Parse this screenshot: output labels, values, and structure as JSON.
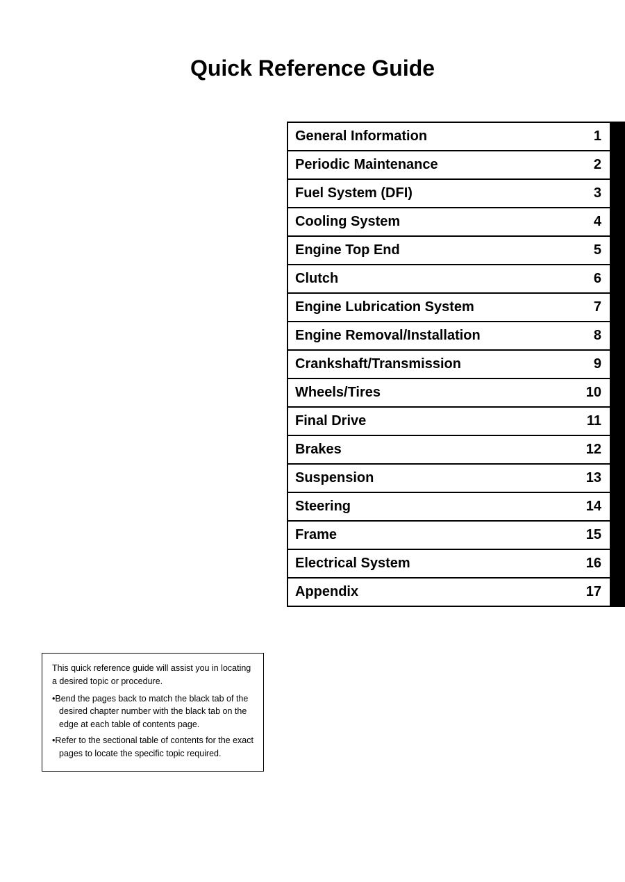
{
  "page": {
    "title": "Quick Reference Guide",
    "toc_items": [
      {
        "label": "General Information",
        "number": "1"
      },
      {
        "label": "Periodic Maintenance",
        "number": "2"
      },
      {
        "label": "Fuel System (DFI)",
        "number": "3"
      },
      {
        "label": "Cooling System",
        "number": "4"
      },
      {
        "label": "Engine Top End",
        "number": "5"
      },
      {
        "label": "Clutch",
        "number": "6"
      },
      {
        "label": "Engine Lubrication System",
        "number": "7"
      },
      {
        "label": "Engine Removal/Installation",
        "number": "8"
      },
      {
        "label": "Crankshaft/Transmission",
        "number": "9"
      },
      {
        "label": "Wheels/Tires",
        "number": "10"
      },
      {
        "label": "Final Drive",
        "number": "11"
      },
      {
        "label": "Brakes",
        "number": "12"
      },
      {
        "label": "Suspension",
        "number": "13"
      },
      {
        "label": "Steering",
        "number": "14"
      },
      {
        "label": "Frame",
        "number": "15"
      },
      {
        "label": "Electrical System",
        "number": "16"
      },
      {
        "label": "Appendix",
        "number": "17"
      }
    ],
    "info_box": {
      "intro": "This quick reference guide will assist you in locating a desired topic or procedure.",
      "bullet1": "•Bend the pages back to match the black tab of the desired chapter number with the black tab on the edge at each table of contents page.",
      "bullet2": "•Refer to the sectional table of contents for the exact pages to locate the specific topic required."
    }
  }
}
